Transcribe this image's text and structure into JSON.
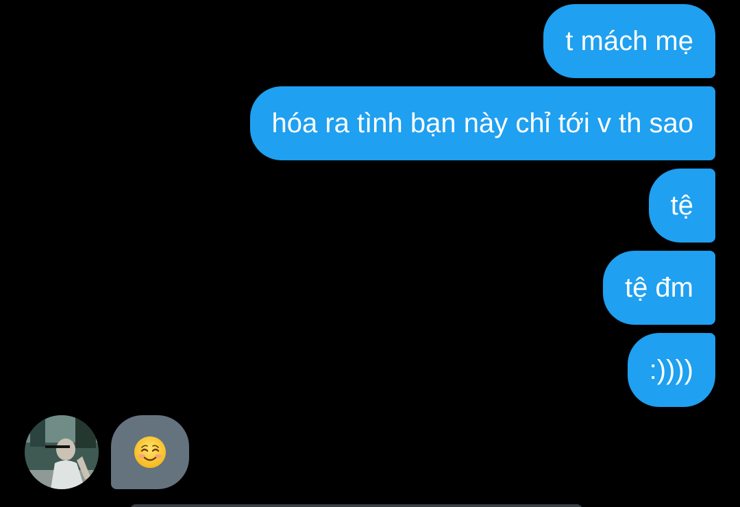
{
  "messages": {
    "outgoing": [
      {
        "text": "t mách mẹ"
      },
      {
        "text": "hóa ra tình bạn này chỉ tới v th sao"
      },
      {
        "text": "tệ"
      },
      {
        "text": "tệ đm"
      },
      {
        "text": ":))))"
      }
    ],
    "incoming": [
      {
        "emoji": "smiling-face-emoji"
      }
    ]
  },
  "colors": {
    "background": "#000000",
    "outgoing_bubble": "#1fa0f0",
    "incoming_bubble": "#65737f",
    "text": "#ffffff"
  }
}
